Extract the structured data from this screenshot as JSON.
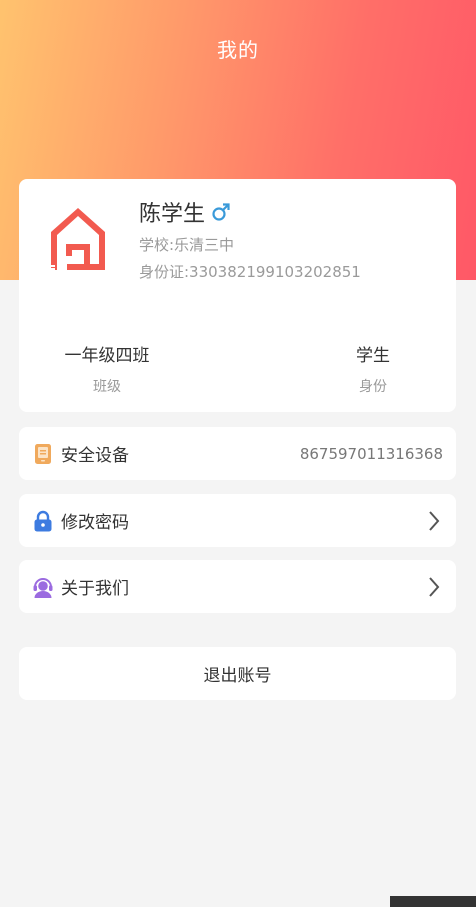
{
  "header": {
    "title": "我的"
  },
  "profile": {
    "name": "陈学生",
    "gender_symbol": "♂",
    "school": "学校:乐清三中",
    "id_card": "身份证:330382199103202851",
    "class_value": "一年级四班",
    "class_label": "班级",
    "role_value": "学生",
    "role_label": "身份"
  },
  "menu": {
    "device": {
      "label": "安全设备",
      "value": "867597011316368",
      "icon": "device-icon"
    },
    "password": {
      "label": "修改密码",
      "icon": "lock-icon"
    },
    "about": {
      "label": "关于我们",
      "icon": "support-agent-icon"
    }
  },
  "logout": {
    "label": "退出账号"
  },
  "colors": {
    "gradient_start": "#ffc36e",
    "gradient_end": "#ff5867",
    "logo": "#f25a4f",
    "gender": "#3a9ad9",
    "lock": "#3d7be0",
    "about": "#9b6be0",
    "device": "#f0a95c"
  }
}
